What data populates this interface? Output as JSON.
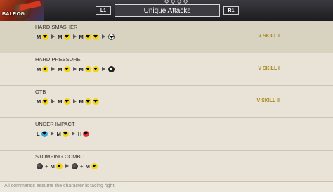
{
  "header": {
    "character": "BALROG",
    "left_button": "L1",
    "right_button": "R1",
    "title": "Unique Attacks"
  },
  "moves": [
    {
      "name": "HARD SMASHER",
      "tag": "V SKILL I",
      "sequence": [
        {
          "t": "key",
          "v": "M"
        },
        {
          "t": "btn",
          "c": "y"
        },
        {
          "t": "arrow"
        },
        {
          "t": "key",
          "v": "M"
        },
        {
          "t": "btn",
          "c": "y"
        },
        {
          "t": "arrow"
        },
        {
          "t": "key",
          "v": "M"
        },
        {
          "t": "btn",
          "c": "y"
        },
        {
          "t": "btn",
          "c": "y"
        },
        {
          "t": "arrow"
        },
        {
          "t": "btn",
          "c": "w"
        }
      ]
    },
    {
      "name": "HARD PRESSURE",
      "tag": "V SKILL I",
      "sequence": [
        {
          "t": "key",
          "v": "M"
        },
        {
          "t": "btn",
          "c": "y"
        },
        {
          "t": "arrow"
        },
        {
          "t": "key",
          "v": "M"
        },
        {
          "t": "btn",
          "c": "y"
        },
        {
          "t": "arrow"
        },
        {
          "t": "key",
          "v": "M"
        },
        {
          "t": "btn",
          "c": "y"
        },
        {
          "t": "btn",
          "c": "y"
        },
        {
          "t": "arrow"
        },
        {
          "t": "btn",
          "c": "k2"
        }
      ]
    },
    {
      "name": "OTB",
      "tag": "V SKILL II",
      "sequence": [
        {
          "t": "key",
          "v": "M"
        },
        {
          "t": "btn",
          "c": "y"
        },
        {
          "t": "arrow"
        },
        {
          "t": "key",
          "v": "M"
        },
        {
          "t": "btn",
          "c": "y"
        },
        {
          "t": "arrow"
        },
        {
          "t": "key",
          "v": "M"
        },
        {
          "t": "btn",
          "c": "y"
        },
        {
          "t": "btn",
          "c": "y"
        }
      ]
    },
    {
      "name": "UNDER IMPACT",
      "tag": "",
      "sequence": [
        {
          "t": "key",
          "v": "L"
        },
        {
          "t": "btn",
          "c": "b"
        },
        {
          "t": "arrow"
        },
        {
          "t": "key",
          "v": "M"
        },
        {
          "t": "btn",
          "c": "y"
        },
        {
          "t": "arrow"
        },
        {
          "t": "key",
          "v": "H"
        },
        {
          "t": "btn",
          "c": "r"
        }
      ]
    },
    {
      "name": "STOMPING COMBO",
      "tag": "",
      "sequence": [
        {
          "t": "stick"
        },
        {
          "t": "plus",
          "v": "+"
        },
        {
          "t": "key",
          "v": "M"
        },
        {
          "t": "btn",
          "c": "y"
        },
        {
          "t": "arrow"
        },
        {
          "t": "stick"
        },
        {
          "t": "plus",
          "v": "+"
        },
        {
          "t": "key",
          "v": "M"
        },
        {
          "t": "btn",
          "c": "y"
        }
      ]
    }
  ],
  "footer": {
    "note": "All commands assume the character is facing right."
  },
  "colors": {
    "tag": "#a6891a",
    "light": "#36a8e0",
    "medium": "#f2d410",
    "heavy": "#e03232"
  }
}
